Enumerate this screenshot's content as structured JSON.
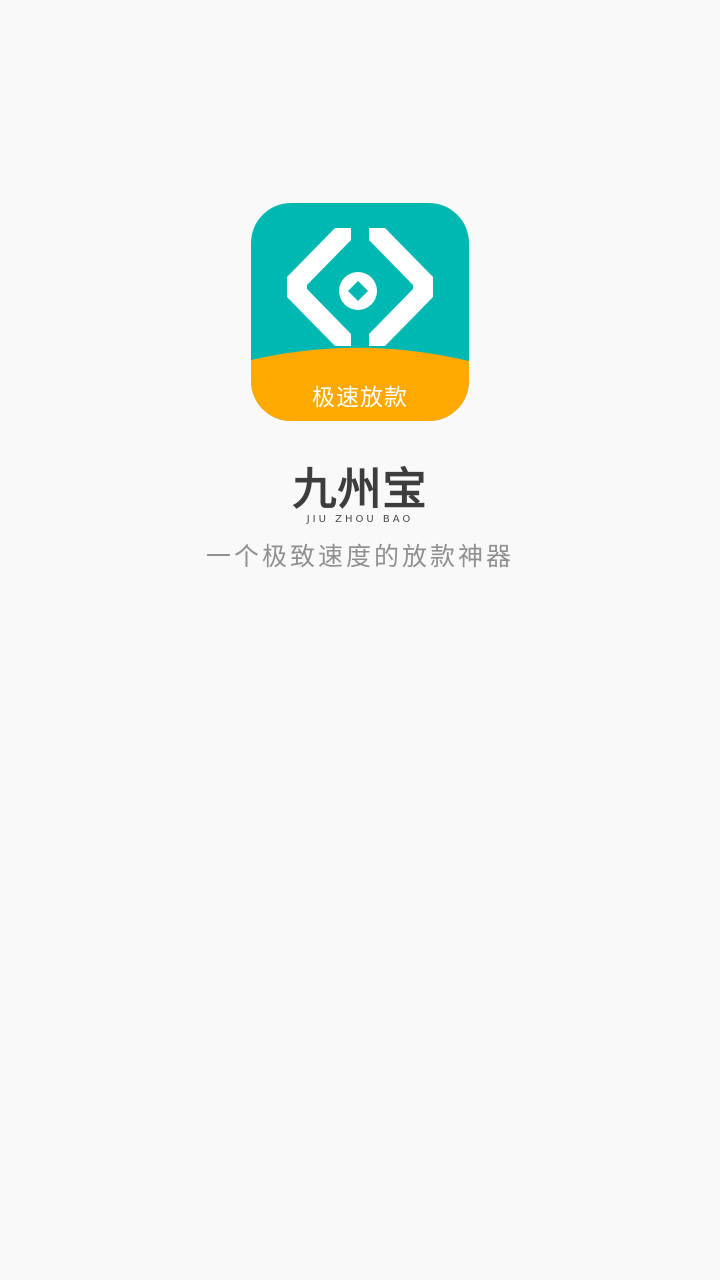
{
  "app_icon": {
    "banner_label": "极速放款",
    "colors": {
      "main": "#00b8b2",
      "banner": "#ffa800",
      "glyph": "#ffffff"
    }
  },
  "brand": {
    "name": "九州宝",
    "pinyin": "JIU ZHOU BAO"
  },
  "tagline": "一个极致速度的放款神器"
}
